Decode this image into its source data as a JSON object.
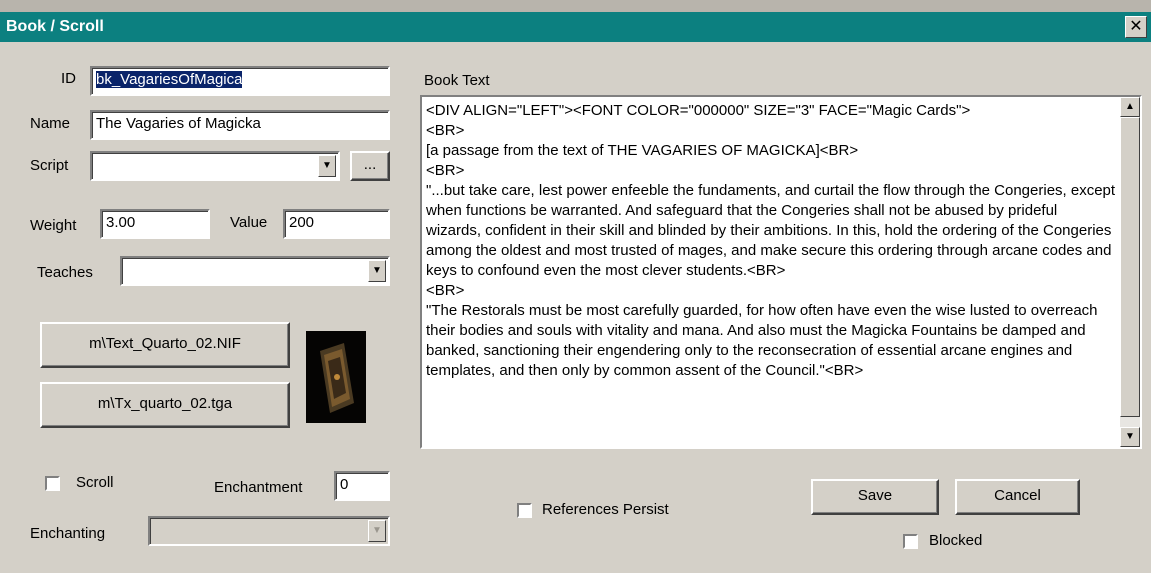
{
  "window": {
    "title": "Book / Scroll",
    "close_glyph": "✕"
  },
  "form": {
    "id_label": "ID",
    "id_value": "bk_VagariesOfMagica",
    "name_label": "Name",
    "name_value": "The Vagaries of Magicka",
    "script_label": "Script",
    "script_value": "",
    "script_browse_label": "...",
    "weight_label": "Weight",
    "weight_value": "3.00",
    "value_label": "Value",
    "value_value": "200",
    "teaches_label": "Teaches",
    "teaches_value": "",
    "model_button": "m\\Text_Quarto_02.NIF",
    "icon_button": "m\\Tx_quarto_02.tga",
    "scroll_label": "Scroll",
    "enchantment_label": "Enchantment",
    "enchantment_value": "0",
    "enchanting_label": "Enchanting",
    "enchanting_value": ""
  },
  "book_text": {
    "label": "Book Text",
    "content": "<DIV ALIGN=\"LEFT\"><FONT COLOR=\"000000\" SIZE=\"3\" FACE=\"Magic Cards\">\n<BR>\n[a passage from the text of THE VAGARIES OF MAGICKA]<BR>\n<BR>\n\"...but take care, lest power enfeeble the fundaments, and curtail the flow through the Congeries, except when functions be warranted. And safeguard that the Congeries shall not be abused by prideful wizards, confident in their skill and blinded by their ambitions. In this, hold the ordering of the Congeries among the oldest and most trusted of mages, and make secure this ordering through arcane codes and keys to confound even the most clever students.<BR>\n<BR>\n\"The Restorals must be most carefully guarded, for how often have even the wise lusted to overreach their bodies and souls with vitality and mana. And also must the Magicka Fountains be damped and banked, sanctioning their engendering only to the reconsecration of essential arcane engines and templates, and then only by common assent of the Council.\"<BR>"
  },
  "footer": {
    "references_persist_label": "References Persist",
    "save_label": "Save",
    "cancel_label": "Cancel",
    "blocked_label": "Blocked"
  },
  "icons": {
    "dropdown": "chevron-down-icon",
    "scroll_up": "arrow-up-icon",
    "scroll_down": "arrow-down-icon"
  }
}
